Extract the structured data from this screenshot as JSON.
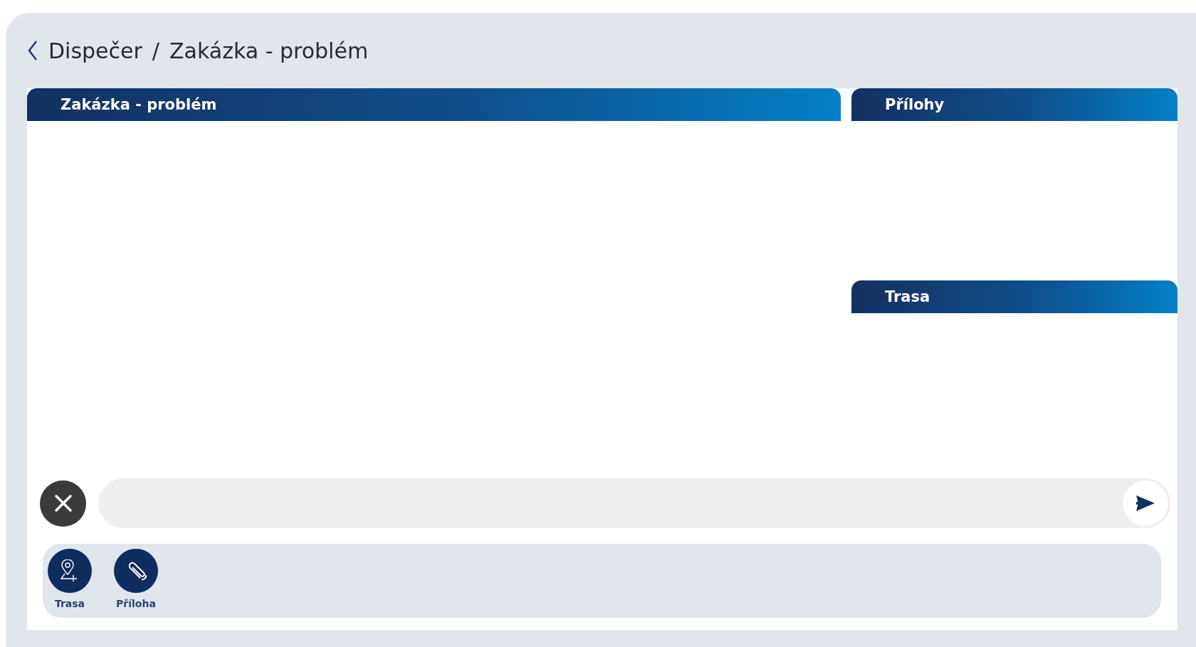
{
  "breadcrumb": [
    "Dispečer",
    "Zakázka - problém"
  ],
  "breadcrumb_separator": "/",
  "main_panel": {
    "title": "Zakázka - problém"
  },
  "side_panels": [
    {
      "title": "Přílohy"
    },
    {
      "title": "Trasa"
    }
  ],
  "actions": [
    {
      "kind": "route",
      "label": "Trasa"
    },
    {
      "kind": "attachment",
      "label": "Příloha"
    }
  ]
}
